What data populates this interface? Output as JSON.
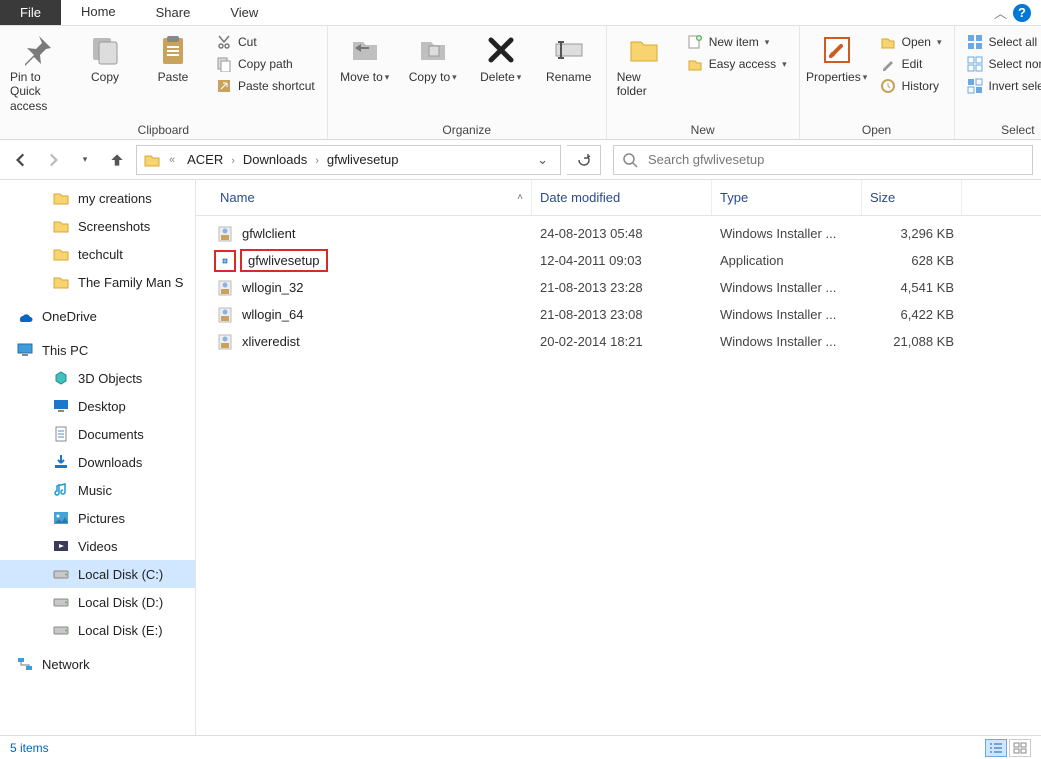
{
  "tabs": {
    "file": "File",
    "home": "Home",
    "share": "Share",
    "view": "View"
  },
  "ribbon": {
    "clipboard": {
      "label": "Clipboard",
      "pin": "Pin to Quick access",
      "copy": "Copy",
      "paste": "Paste",
      "cut": "Cut",
      "copy_path": "Copy path",
      "paste_shortcut": "Paste shortcut"
    },
    "organize": {
      "label": "Organize",
      "move_to": "Move to",
      "copy_to": "Copy to",
      "delete": "Delete",
      "rename": "Rename"
    },
    "new": {
      "label": "New",
      "new_folder": "New folder",
      "new_item": "New item",
      "easy_access": "Easy access"
    },
    "open": {
      "label": "Open",
      "properties": "Properties",
      "open": "Open",
      "edit": "Edit",
      "history": "History"
    },
    "select": {
      "label": "Select",
      "select_all": "Select all",
      "select_none": "Select none",
      "invert": "Invert selection"
    }
  },
  "breadcrumb": {
    "items": [
      "ACER",
      "Downloads",
      "gfwlivesetup"
    ]
  },
  "search": {
    "placeholder": "Search gfwlivesetup"
  },
  "sidebar": {
    "folders": [
      {
        "label": "my creations",
        "icon": "folder"
      },
      {
        "label": "Screenshots",
        "icon": "folder"
      },
      {
        "label": "techcult",
        "icon": "folder"
      },
      {
        "label": "The Family Man S",
        "icon": "folder"
      }
    ],
    "onedrive": "OneDrive",
    "thispc": "This PC",
    "pc_items": [
      {
        "label": "3D Objects",
        "icon": "3d"
      },
      {
        "label": "Desktop",
        "icon": "desktop"
      },
      {
        "label": "Documents",
        "icon": "docs"
      },
      {
        "label": "Downloads",
        "icon": "downloads"
      },
      {
        "label": "Music",
        "icon": "music"
      },
      {
        "label": "Pictures",
        "icon": "pictures"
      },
      {
        "label": "Videos",
        "icon": "videos"
      },
      {
        "label": "Local Disk (C:)",
        "icon": "disk",
        "selected": true
      },
      {
        "label": "Local Disk (D:)",
        "icon": "disk"
      },
      {
        "label": "Local Disk (E:)",
        "icon": "disk"
      }
    ],
    "network": "Network"
  },
  "columns": {
    "name": "Name",
    "date": "Date modified",
    "type": "Type",
    "size": "Size"
  },
  "files": [
    {
      "name": "gfwlclient",
      "date": "24-08-2013 05:48",
      "type": "Windows Installer ...",
      "size": "3,296 KB",
      "icon": "msi"
    },
    {
      "name": "gfwlivesetup",
      "date": "12-04-2011 09:03",
      "type": "Application",
      "size": "628 KB",
      "icon": "exe",
      "highlight": true
    },
    {
      "name": "wllogin_32",
      "date": "21-08-2013 23:28",
      "type": "Windows Installer ...",
      "size": "4,541 KB",
      "icon": "msi"
    },
    {
      "name": "wllogin_64",
      "date": "21-08-2013 23:08",
      "type": "Windows Installer ...",
      "size": "6,422 KB",
      "icon": "msi"
    },
    {
      "name": "xliveredist",
      "date": "20-02-2014 18:21",
      "type": "Windows Installer ...",
      "size": "21,088 KB",
      "icon": "msi"
    }
  ],
  "status": {
    "items": "5 items"
  }
}
